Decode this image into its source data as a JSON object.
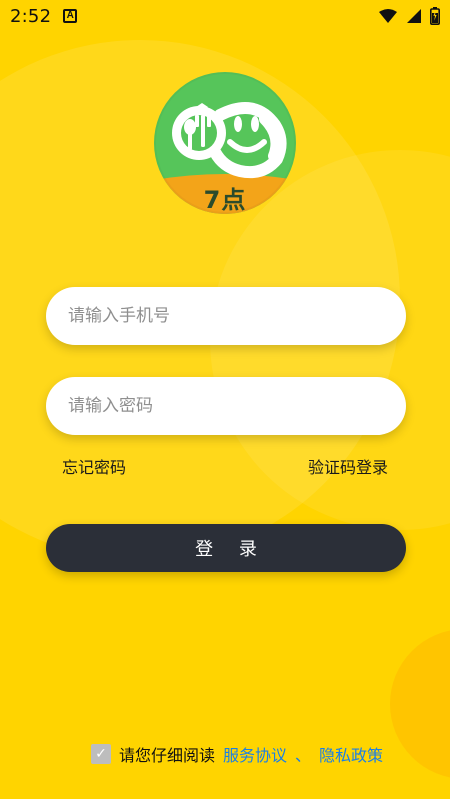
{
  "status_bar": {
    "time": "2:52",
    "badge": "A",
    "icons": [
      "wifi-icon",
      "signal-icon",
      "battery-icon"
    ]
  },
  "logo": {
    "text": "7点",
    "icon": "smiley-fork-spoon-logo",
    "colors": {
      "green": "#56C55A",
      "orange": "#F3A419",
      "white": "#FFFFFF"
    }
  },
  "form": {
    "phone_placeholder": "请输入手机号",
    "password_placeholder": "请输入密码",
    "forgot_password": "忘记密码",
    "verification_login": "验证码登录",
    "login_button": "登 录"
  },
  "agreement": {
    "prefix": "请您仔细阅读",
    "service": "服务协议",
    "separator": "、",
    "privacy": "隐私政策",
    "checked": true
  },
  "theme": {
    "background": "#FFD400",
    "button": "#2B2F38",
    "link": "#1B7FE6"
  }
}
